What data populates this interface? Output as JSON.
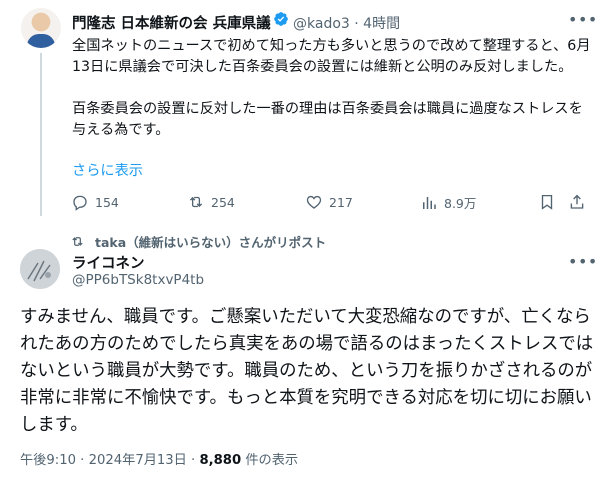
{
  "tweet": {
    "author_name": "門隆志 日本維新の会 兵庫県議",
    "handle": "@kado3",
    "separator": "·",
    "time": "4時間",
    "text": "全国ネットのニュースで初めて知った方も多いと思うので改めて整理すると、6月13日に県議会で可決した百条委員会の設置には維新と公明のみ反対しました。\n\n百条委員会の設置に反対した一番の理由は百条委員会は職員に過度なストレスを与える為です。",
    "show_more": "さらに表示",
    "replies": "154",
    "reposts": "254",
    "likes": "217",
    "views": "8.9万"
  },
  "repost_note": "taka（維新はいらない）さんがリポスト",
  "quote": {
    "author_name": "ライコネン",
    "handle": "@PP6bTSk8txvP4tb",
    "text": "すみません、職員です。ご懸案いただいて大変恐縮なのですが、亡くなられたあの方のためでしたら真実をあの場で語るのはまったくストレスではないという職員が大勢です。職員のため、という刀を振りかざされるのが非常に非常に不愉快です。もっと本質を究明できる対応を切に切にお願いします。",
    "timestamp": "午後9:10 · 2024年7月13日 · ",
    "view_count": "8,880",
    "view_label": " 件の表示"
  },
  "icons": {
    "verified": "verified-badge-icon",
    "reply": "reply-icon",
    "repost": "repost-icon",
    "like": "heart-icon",
    "views": "views-chart-icon",
    "bookmark": "bookmark-icon",
    "share": "share-icon",
    "more": "more-dots-icon"
  },
  "colors": {
    "accent": "#1d9bf0",
    "muted": "#536471",
    "text": "#0f1419"
  }
}
